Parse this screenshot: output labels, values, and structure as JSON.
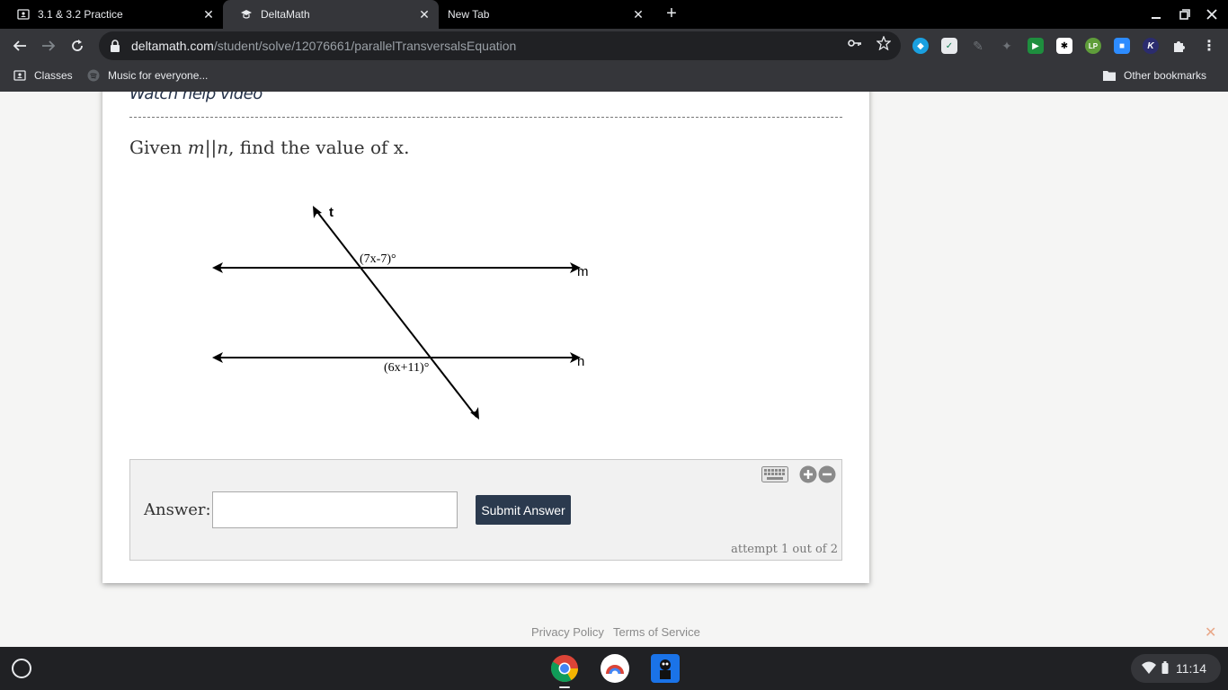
{
  "browser": {
    "tabs": [
      {
        "title": "3.1 & 3.2 Practice",
        "active": false
      },
      {
        "title": "DeltaMath",
        "active": true
      },
      {
        "title": "New Tab",
        "active": false
      }
    ],
    "url_host": "deltamath.com",
    "url_path": "/student/solve/12076661/parallelTransversalsEquation",
    "bookmarks": [
      {
        "label": "Classes"
      },
      {
        "label": "Music for everyone..."
      }
    ],
    "other_bookmarks": "Other bookmarks"
  },
  "page": {
    "help_link": "Watch help video",
    "question": {
      "prefix": "Given ",
      "math_m": "m",
      "parallel": "||",
      "math_n": "n",
      "suffix": ", find the value of x."
    },
    "diagram": {
      "label_t": "t",
      "label_m": "m",
      "label_n": "n",
      "angle_top": "(7x-7)°",
      "angle_bottom": "(6x+11)°"
    },
    "answer": {
      "label": "Answer:",
      "value": "",
      "submit_label": "Submit Answer",
      "attempt_text": "attempt 1 out of 2"
    },
    "footer": {
      "privacy": "Privacy Policy",
      "terms": "Terms of Service"
    }
  },
  "shelf": {
    "time": "11:14"
  },
  "colors": {
    "submit_bg": "#2b3a4e",
    "tab_active": "#35363a",
    "tabbar": "#000000"
  }
}
